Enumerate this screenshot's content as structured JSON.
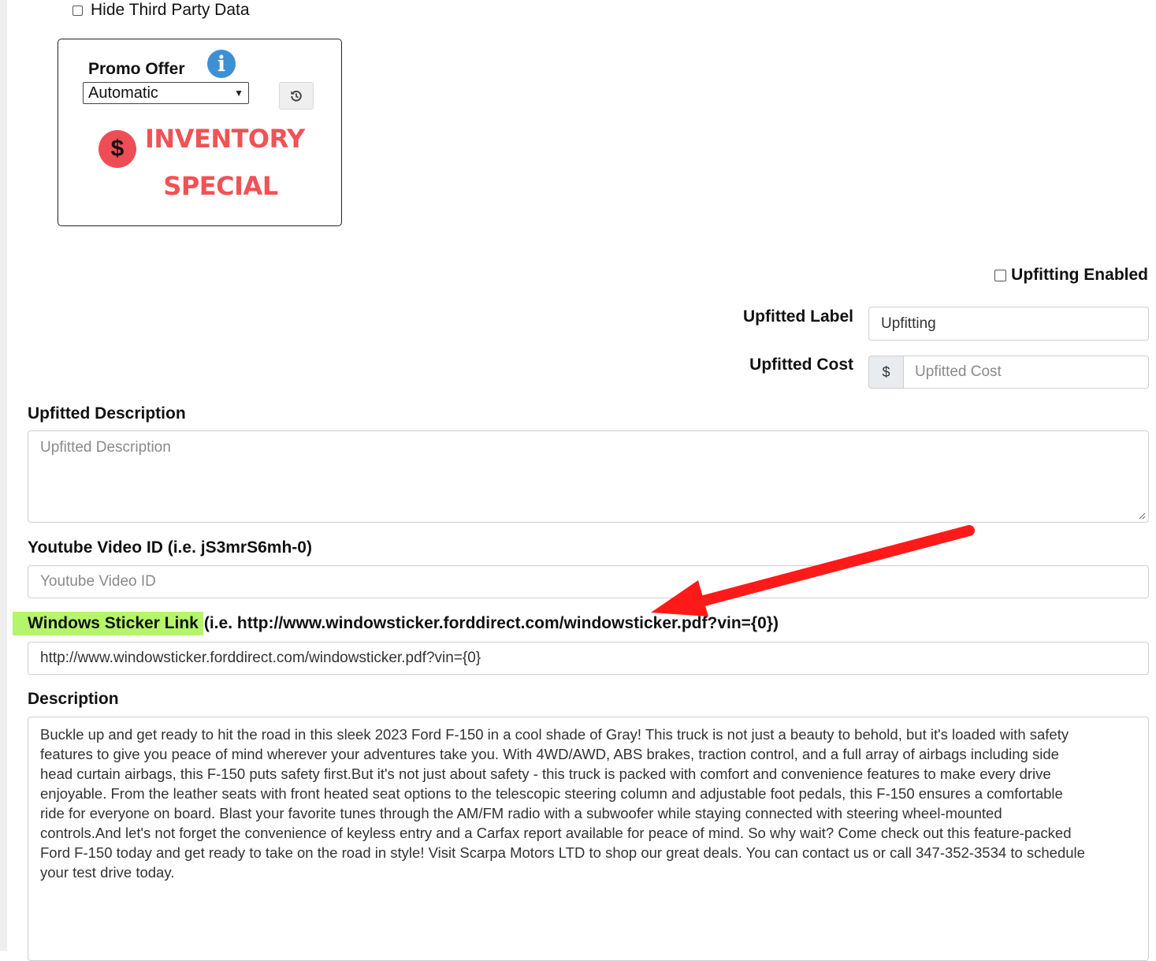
{
  "hide_third_party": {
    "label": "Hide Third Party Data",
    "checked": false
  },
  "promo": {
    "label": "Promo Offer",
    "info_icon": "info-icon",
    "select_value": "Automatic",
    "reset_icon": "history-reset-icon",
    "badge_icon": "dollar-icon",
    "badge_line1": "INVENTORY",
    "badge_line2": "SPECIAL",
    "badge_color": "#f05256"
  },
  "upfitting": {
    "enabled_label": "Upfitting Enabled",
    "enabled_checked": false,
    "label_label": "Upfitted Label",
    "label_value": "Upfitting",
    "cost_label": "Upfitted Cost",
    "cost_prefix": "$",
    "cost_placeholder": "Upfitted Cost",
    "description_label": "Upfitted Description",
    "description_placeholder": "Upfitted Description"
  },
  "youtube": {
    "label": "Youtube Video ID (i.e. jS3mrS6mh-0)",
    "placeholder": "Youtube Video ID"
  },
  "window_sticker": {
    "label": "Windows Sticker Link",
    "hint": "(i.e. http://www.windowsticker.forddirect.com/windowsticker.pdf?vin={0})",
    "value": "http://www.windowsticker.forddirect.com/windowsticker.pdf?vin={0}",
    "highlight_color": "#b5f56b"
  },
  "description": {
    "label": "Description",
    "lines": [
      "Buckle up and get ready to hit the road in this sleek 2023 Ford F-150 in a cool shade of Gray! This truck is not just a beauty to behold, but it's loaded with safety",
      "features to give you peace of mind wherever your adventures take you. With 4WD/AWD, ABS brakes, traction control, and a full array of airbags including side",
      "head curtain airbags, this F-150 puts safety first.But it's not just about safety - this truck is packed with comfort and convenience features to make every drive",
      "enjoyable. From the leather seats with front heated seat options to the telescopic steering column and adjustable foot pedals, this F-150 ensures a comfortable",
      "ride for everyone on board. Blast your favorite tunes through the AM/FM radio with a subwoofer while staying connected with steering wheel-mounted",
      "controls.And let's not forget the convenience of keyless entry and a Carfax report available for peace of mind. So why wait? Come check out this feature-packed",
      "Ford F-150 today and get ready to take on the road in style! Visit Scarpa Motors LTD to shop our great deals. You can contact us or call 347-352-3534 to schedule",
      "your test drive today."
    ]
  },
  "annotation": {
    "arrow_color": "#ff1a1a"
  }
}
